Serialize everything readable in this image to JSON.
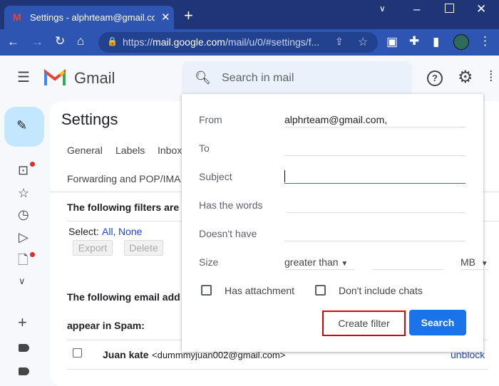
{
  "browser": {
    "tab_title": "Settings - alphrteam@gmail.com",
    "new_tab": "+",
    "url_prefix": "https://",
    "url_host": "mail.google.com",
    "url_path": "/mail/u/0/#settings/f..."
  },
  "gmail": {
    "brand": "Gmail",
    "search_placeholder": "Search in mail"
  },
  "settings": {
    "title": "Settings",
    "tabs": [
      "General",
      "Labels",
      "Inbox"
    ],
    "tabs_row2": "Forwarding and POP/IMA",
    "filters_heading": "The following filters are",
    "select_label": "Select:",
    "select_all": "All,",
    "select_none": "None",
    "export": "Export",
    "delete": "Delete",
    "blocked_heading": "The following email add",
    "blocked_heading2": "appear in Spam:",
    "blocked_name": "Juan kate",
    "blocked_email": "<dummmyjuan002@gmail.com>",
    "unblock": "unblock"
  },
  "filter_popup": {
    "from_label": "From",
    "from_value": "alphrteam@gmail.com,",
    "to_label": "To",
    "to_value": "",
    "subject_label": "Subject",
    "subject_value": "",
    "words_label": "Has the words",
    "words_value": "",
    "doesnt_label": "Doesn't have",
    "doesnt_value": "",
    "size_label": "Size",
    "size_op": "greater than",
    "size_value": "",
    "size_unit": "MB",
    "has_attachment": "Has attachment",
    "has_attachment_checked": false,
    "no_chats": "Don't include chats",
    "no_chats_checked": false,
    "create_filter": "Create filter",
    "search": "Search"
  },
  "colors": {
    "accent": "#1a73e8",
    "highlight": "#e00000",
    "chrome": "#2f55b3"
  }
}
